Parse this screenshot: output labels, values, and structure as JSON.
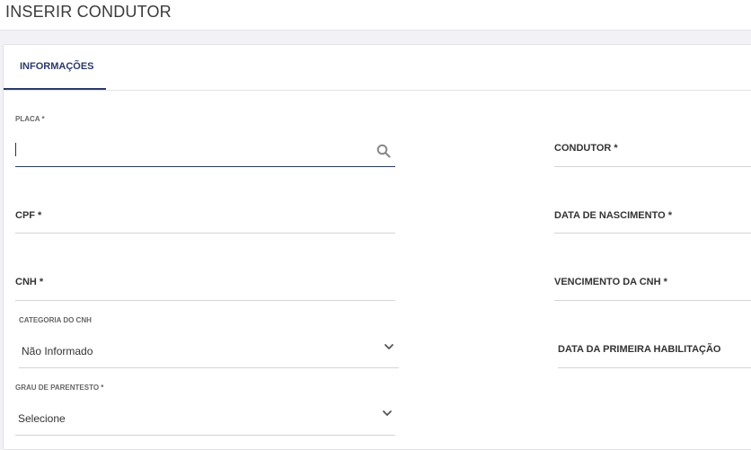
{
  "page": {
    "title": "INSERIR CONDUTOR"
  },
  "tabs": [
    {
      "label": "INFORMAÇÕES",
      "active": true
    }
  ],
  "form": {
    "placa": {
      "label": "PLACA *",
      "value": "",
      "icon": "search-icon"
    },
    "condutor": {
      "label": "CONDUTOR *"
    },
    "cpf": {
      "label": "CPF *"
    },
    "data_nascimento": {
      "label": "DATA DE NASCIMENTO *"
    },
    "cnh": {
      "label": "CNH *"
    },
    "vencimento_cnh": {
      "label": "VENCIMENTO DA CNH *"
    },
    "categoria_cnh": {
      "label": "CATEGORIA DO CNH",
      "selected": "Não Informado",
      "icon": "chevron-down-icon"
    },
    "data_primeira_habilitacao": {
      "label": "DATA DA PRIMEIRA HABILITAÇÃO"
    },
    "grau_parentesto": {
      "label": "GRAU DE PARENTESTO *",
      "selected": "Selecione",
      "icon": "chevron-down-icon"
    }
  },
  "colors": {
    "accent": "#2b3a67",
    "line": "#d4d4d4",
    "background": "#f1f1f6"
  }
}
